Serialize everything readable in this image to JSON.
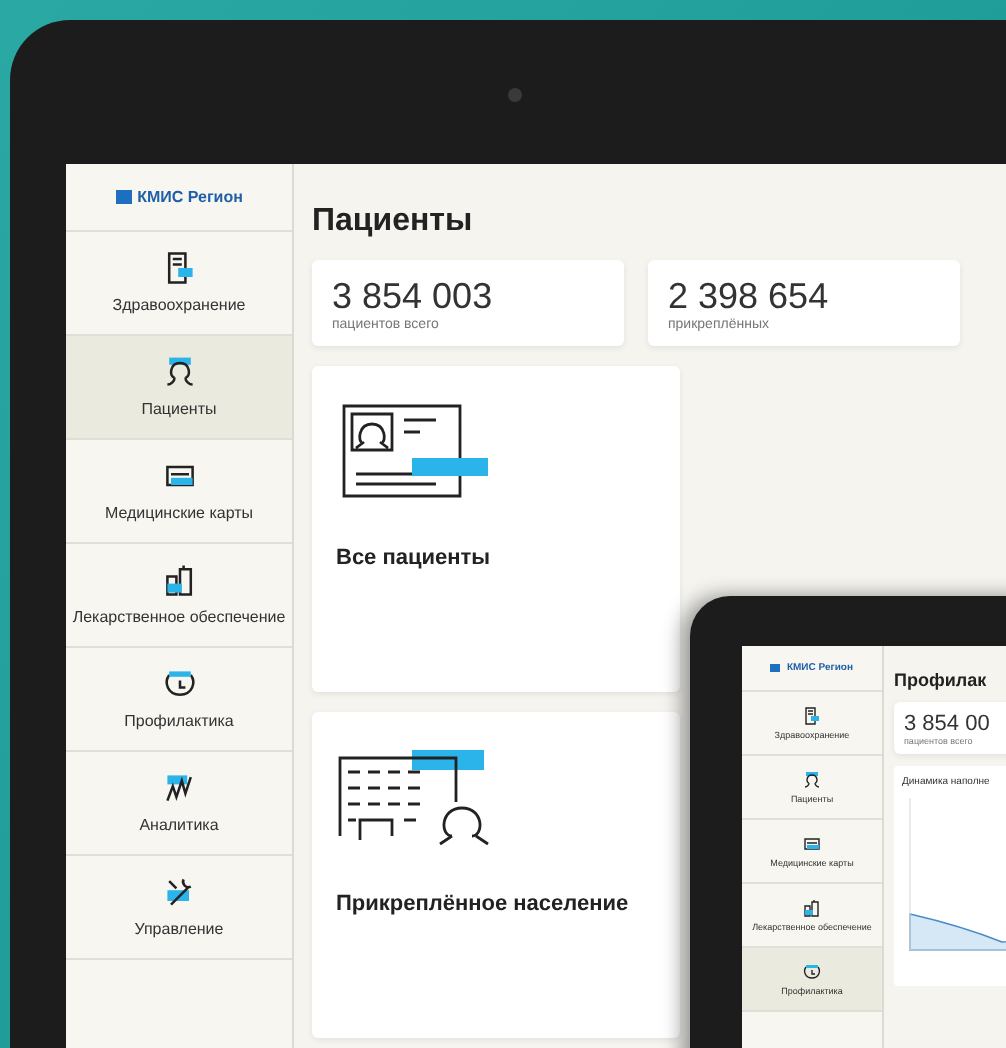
{
  "main_tablet": {
    "logo": "КМИС Регион",
    "sidebar": [
      {
        "label": "Здравоохранение",
        "kind": "document",
        "selected": false
      },
      {
        "label": "Пациенты",
        "kind": "person",
        "selected": true
      },
      {
        "label": "Медицинские карты",
        "kind": "card",
        "selected": false
      },
      {
        "label": "Лекарственное обеспечение",
        "kind": "bottles",
        "selected": false
      },
      {
        "label": "Профилактика",
        "kind": "clock",
        "selected": false
      },
      {
        "label": "Аналитика",
        "kind": "chart",
        "selected": false
      },
      {
        "label": "Управление",
        "kind": "tools",
        "selected": false
      }
    ],
    "title": "Пациенты",
    "stats": [
      {
        "value": "3 854 003",
        "caption": "пациентов всего"
      },
      {
        "value": "2 398 654",
        "caption": "прикреплённых"
      }
    ],
    "sections": [
      {
        "label": "Все пациенты",
        "kind": "id-card"
      },
      {
        "label": "Прикреплённое население",
        "kind": "roster"
      }
    ]
  },
  "second_tablet": {
    "logo": "КМИС Регион",
    "sidebar": [
      {
        "label": "Здравоохранение",
        "kind": "document",
        "selected": false
      },
      {
        "label": "Пациенты",
        "kind": "person",
        "selected": false
      },
      {
        "label": "Медицинские карты",
        "kind": "card",
        "selected": false
      },
      {
        "label": "Лекарственное обеспечение",
        "kind": "bottles",
        "selected": false
      },
      {
        "label": "Профилактика",
        "kind": "clock",
        "selected": true
      }
    ],
    "title": "Профилак",
    "stats": [
      {
        "value": "3 854 00",
        "caption": "пациентов всего"
      }
    ],
    "chart": {
      "title": "Динамика наполне"
    }
  }
}
